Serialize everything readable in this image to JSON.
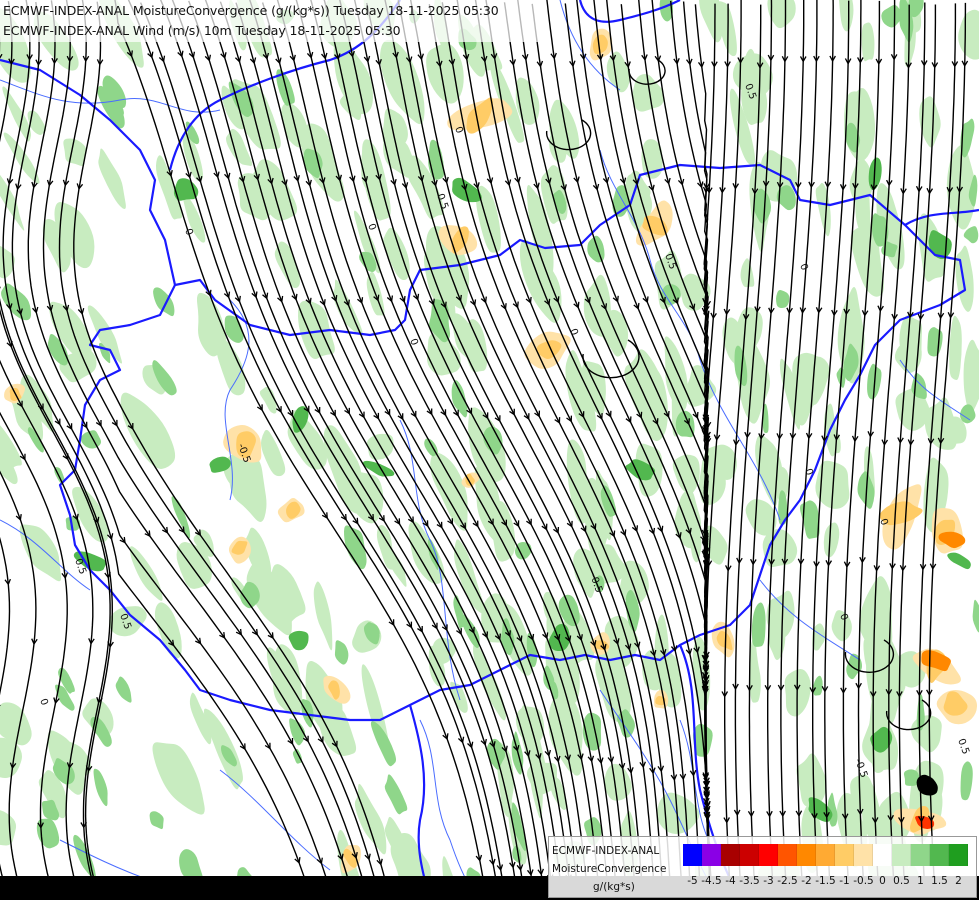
{
  "header": {
    "line1": "ECMWF-INDEX-ANAL MoistureConvergence (g/(kg*s)) Tuesday 18-11-2025 05:30",
    "line2": "ECMWF-INDEX-ANAL Wind (m/s) 10m Tuesday 18-11-2025 05:30"
  },
  "legend": {
    "model": "ECMWF-INDEX-ANAL",
    "variable": "MoistureConvergence",
    "unit": "g/(kg*s)",
    "tick_labels": [
      "-5",
      "-4.5",
      "-4",
      "-3.5",
      "-3",
      "-2.5",
      "-2",
      "-1.5",
      "-1",
      "-0.5",
      "0",
      "0.5",
      "1",
      "1.5",
      "2"
    ],
    "colors": [
      "#0000ff",
      "#8a00e6",
      "#a80000",
      "#cc0000",
      "#ff0000",
      "#ff5500",
      "#ff8800",
      "#ffaa33",
      "#ffcc66",
      "#ffe2a8",
      "#ffffff",
      "#c8ecc0",
      "#8fd68a",
      "#52b84f",
      "#1f9e1f"
    ]
  },
  "map": {
    "field_colors": {
      "green_light": "#c8ecc0",
      "green_mid": "#8fd68a",
      "green_dark": "#52b84f",
      "orange_light": "#ffe2a8",
      "orange_mid": "#ffcc66",
      "orange_dark": "#ff8800",
      "red": "#ff3300",
      "black": "#000000"
    },
    "border_color": "#1a1aff",
    "river_color": "#4a6cff",
    "streamline_color": "#000000",
    "contour_labels": [
      "0",
      "0.5",
      "-0.5",
      "0",
      "0.5",
      "0",
      "-0.5",
      "0.5",
      "0",
      "0.5",
      "0",
      "-0.5",
      "0",
      "0.5",
      "0",
      "0",
      "0",
      "0.5",
      "0"
    ]
  }
}
